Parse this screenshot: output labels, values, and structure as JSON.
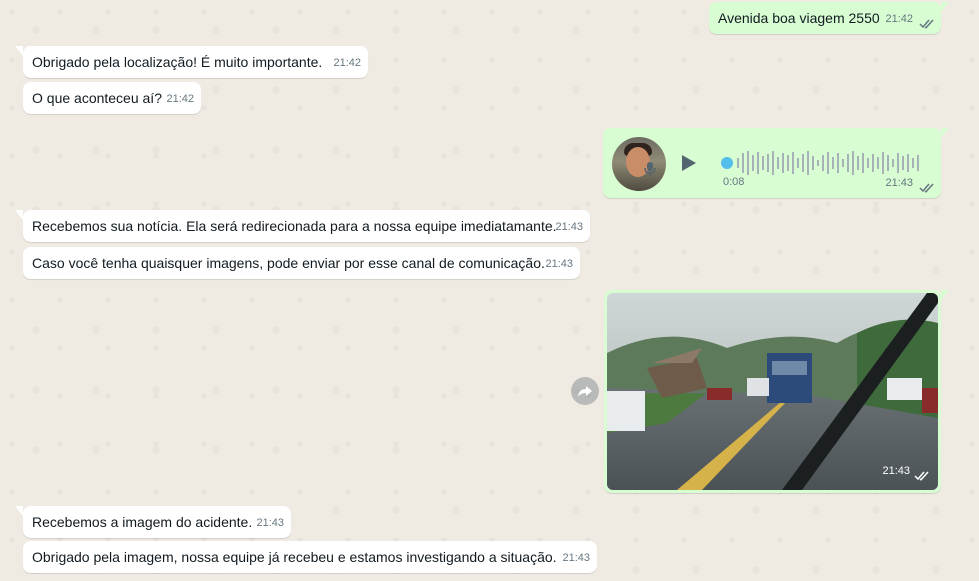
{
  "messages": [
    {
      "direction": "out",
      "type": "text",
      "text": "Avenida boa viagem 2550",
      "time": "21:42"
    },
    {
      "direction": "in",
      "type": "text",
      "text": "Obrigado pela localização! É muito importante.",
      "time": "21:42"
    },
    {
      "direction": "in",
      "type": "text",
      "text": "O que aconteceu aí?",
      "time": "21:42"
    },
    {
      "direction": "out",
      "type": "voice",
      "duration": "0:08",
      "time": "21:43"
    },
    {
      "direction": "in",
      "type": "text",
      "text": "Recebemos sua notícia. Ela será redirecionada para a nossa equipe imediatamante.",
      "time": "21:43"
    },
    {
      "direction": "in",
      "type": "text",
      "text": "Caso você tenha quaisquer imagens, pode enviar por esse canal de comunicação.",
      "time": "21:43"
    },
    {
      "direction": "out",
      "type": "image",
      "time": "21:43"
    },
    {
      "direction": "in",
      "type": "text",
      "text": "Recebemos a imagem do acidente.",
      "time": "21:43"
    },
    {
      "direction": "in",
      "type": "text",
      "text": "Obrigado pela imagem, nossa equipe já recebeu e estamos investigando a situação.",
      "time": "21:43"
    }
  ],
  "colors": {
    "background": "#efeae2",
    "incoming_bubble": "#ffffff",
    "outgoing_bubble": "#d9fdd3",
    "timestamp": "#667781",
    "read_ticks": "#667781",
    "voice_progress_dot": "#53bdeb"
  },
  "icons": {
    "read_receipt": "double-check-icon",
    "play": "play-icon",
    "mic": "microphone-icon",
    "forward": "forward-icon"
  }
}
